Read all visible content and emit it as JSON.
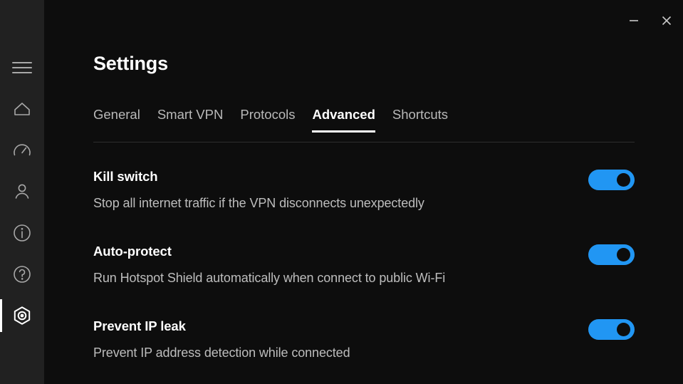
{
  "window": {
    "minimize_label": "—",
    "close_label": "✕"
  },
  "sidebar": {
    "items": [
      {
        "name": "menu",
        "icon": "hamburger-icon",
        "active": false
      },
      {
        "name": "home",
        "icon": "home-icon",
        "active": false
      },
      {
        "name": "speed",
        "icon": "speedometer-icon",
        "active": false
      },
      {
        "name": "account",
        "icon": "person-icon",
        "active": false
      },
      {
        "name": "info",
        "icon": "info-icon",
        "active": false
      },
      {
        "name": "help",
        "icon": "question-icon",
        "active": false
      },
      {
        "name": "settings",
        "icon": "settings-gear-icon",
        "active": true
      }
    ]
  },
  "header": {
    "title": "Settings"
  },
  "tabs": [
    {
      "label": "General",
      "active": false
    },
    {
      "label": "Smart VPN",
      "active": false
    },
    {
      "label": "Protocols",
      "active": false
    },
    {
      "label": "Advanced",
      "active": true
    },
    {
      "label": "Shortcuts",
      "active": false
    }
  ],
  "settings": [
    {
      "title": "Kill switch",
      "description": "Stop all internet traffic if the VPN disconnects unexpectedly",
      "toggle_state": "on"
    },
    {
      "title": "Auto-protect",
      "description": "Run Hotspot Shield automatically when connect to public Wi-Fi",
      "toggle_state": "on"
    },
    {
      "title": "Prevent IP leak",
      "description": "Prevent IP address detection while connected",
      "toggle_state": "on"
    }
  ],
  "colors": {
    "accent": "#2196f3",
    "background": "#0d0d0d",
    "sidebar": "#212121",
    "text_primary": "#ffffff",
    "text_secondary": "#bdbdbd"
  }
}
